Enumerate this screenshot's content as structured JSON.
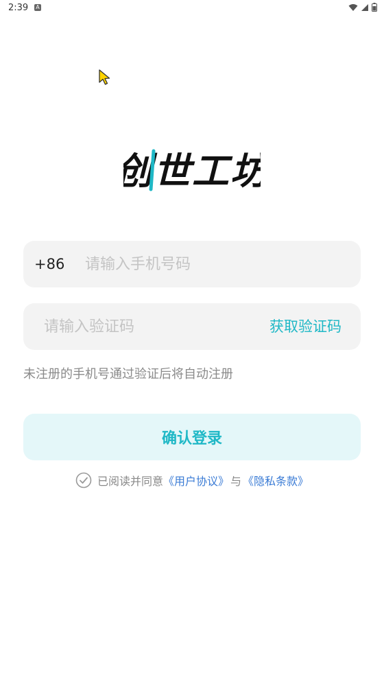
{
  "status_bar": {
    "time": "2:39",
    "notification_glyph": "A"
  },
  "logo": {
    "text": "创世工坊",
    "accent_color": "#1fb8c6"
  },
  "login_form": {
    "country_code": "+86",
    "phone_placeholder": "请输入手机号码",
    "code_placeholder": "请输入验证码",
    "get_code_label": "获取验证码",
    "hint": "未注册的手机号通过验证后将自动注册",
    "submit_label": "确认登录"
  },
  "agreement": {
    "prefix": "已阅读并同意",
    "user_agreement": "《用户协议》",
    "conjunction": "与",
    "privacy_policy": "《隐私条款》"
  },
  "colors": {
    "accent": "#1fb8c6",
    "link": "#3a7bd5",
    "field_bg": "#f3f3f3",
    "button_bg": "#e4f7f9"
  }
}
